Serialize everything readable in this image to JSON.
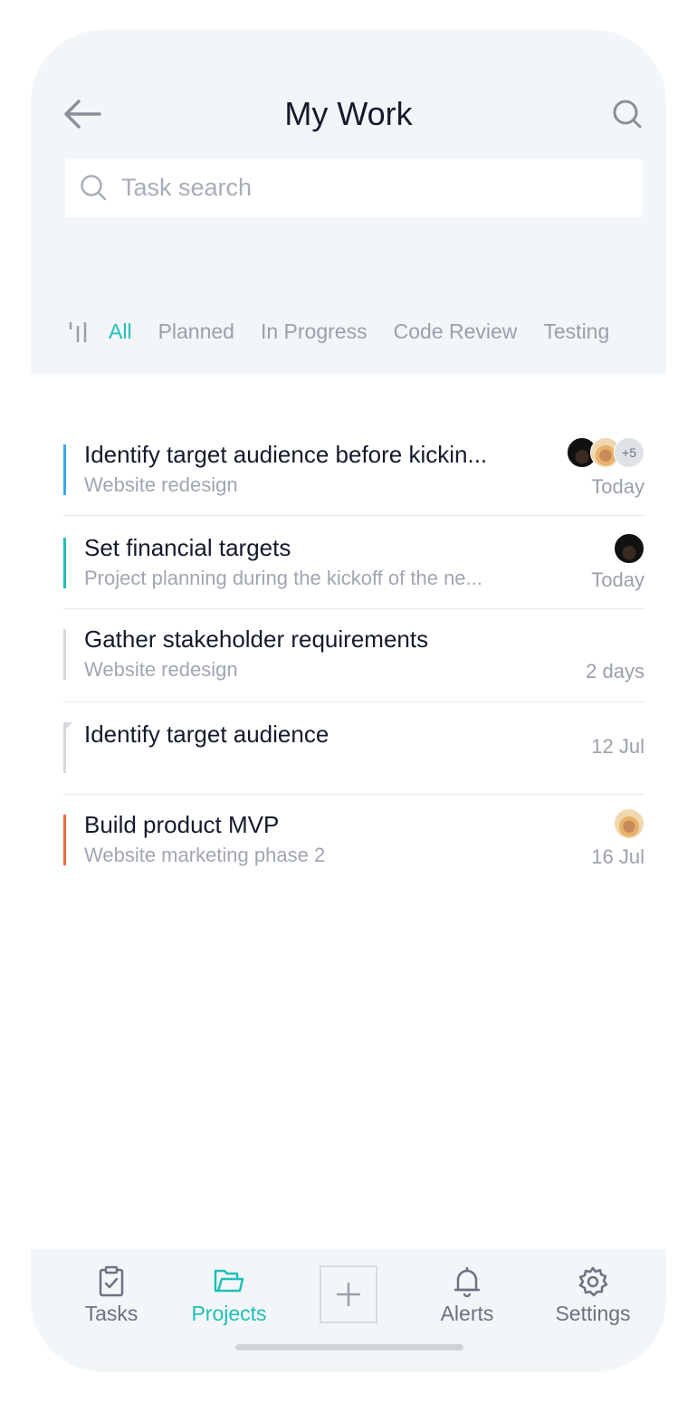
{
  "header": {
    "title": "My Work",
    "search_placeholder": "Task search"
  },
  "filters": [
    {
      "label": "All",
      "active": true
    },
    {
      "label": "Planned",
      "active": false
    },
    {
      "label": "In Progress",
      "active": false
    },
    {
      "label": "Code Review",
      "active": false
    },
    {
      "label": "Testing",
      "active": false
    }
  ],
  "tasks": [
    {
      "title": "Identify target audience before kickin...",
      "subtitle": "Website redesign",
      "date": "Today",
      "accent": "#3aa7f0",
      "avatars": [
        "dark",
        "warm"
      ],
      "more": "+5"
    },
    {
      "title": "Set financial targets",
      "subtitle": "Project planning during the kickoff of the ne...",
      "date": "Today",
      "accent": "#1ec0b6",
      "avatars": [
        "dark"
      ]
    },
    {
      "title": "Gather stakeholder requirements",
      "subtitle": "Website redesign",
      "date": "2 days",
      "accent": "#d5d9de",
      "avatars": []
    },
    {
      "title": "Identify target audience",
      "subtitle": "",
      "date": "12 Jul",
      "accent": "#d5d9de",
      "avatars": []
    },
    {
      "title": "Build product MVP",
      "subtitle": "Website marketing phase 2",
      "date": "16 Jul",
      "accent": "#f06a3b",
      "avatars": [
        "warm"
      ]
    }
  ],
  "tabbar": {
    "tasks_label": "Tasks",
    "projects_label": "Projects",
    "alerts_label": "Alerts",
    "settings_label": "Settings"
  },
  "colors": {
    "accent": "#1ec0b6",
    "header_bg": "#f3f6f9"
  }
}
